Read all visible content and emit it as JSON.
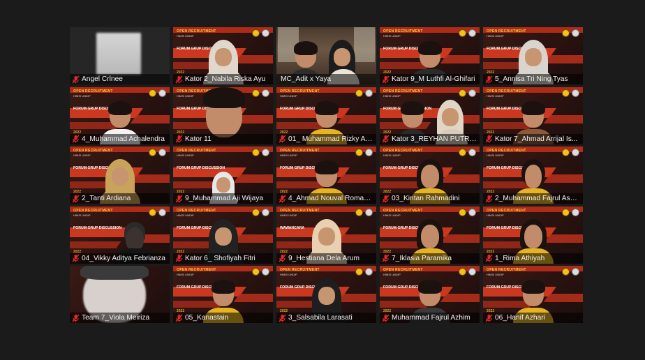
{
  "colors": {
    "background": "#1b1b1b",
    "active_speaker_border": "#c5e23a",
    "muted_icon": "#e02a2a",
    "virtual_bg_accent": "#c9381f",
    "shirt_yellow": "#e6b422"
  },
  "vbg": {
    "brand": "OPEN RECRUITMENT",
    "sub": "HIMSI UNDIP",
    "forum": "FORUM GRUP DISCUSSION",
    "interview": "WAWANCARA",
    "year": "2022"
  },
  "participants": [
    {
      "name": "Angel Crlnee",
      "muted": true,
      "kind": "blank"
    },
    {
      "name": "Kator 2_Nabila Riska Ayu",
      "muted": true,
      "kind": "hijab",
      "hijab": "#e0d8cc"
    },
    {
      "name": "MC_Adit x Yaya",
      "muted": false,
      "kind": "room"
    },
    {
      "name": "Kator 9_M Luthfi Al-Ghifari",
      "muted": true,
      "kind": "male",
      "shirt": "#2c2c2c"
    },
    {
      "name": "5_Annisa Tri Ning Tyas",
      "muted": true,
      "kind": "hijab",
      "hijab": "#d9d4cd"
    },
    {
      "name": "4_Muhammad Achalendra",
      "muted": true,
      "kind": "male",
      "shirt": "#f3f3f3"
    },
    {
      "name": "Kator 11",
      "muted": true,
      "kind": "closeup"
    },
    {
      "name": "01_ Muhammad Rizky Am...",
      "muted": true,
      "kind": "male",
      "shirt": "#e6b422",
      "active": true
    },
    {
      "name": "Kator 3_REYHAN PUTRA ...",
      "muted": true,
      "kind": "duo"
    },
    {
      "name": "Kator 7_Ahmad Arrijal Is...",
      "muted": true,
      "kind": "male",
      "shirt": "#8a5a3a"
    },
    {
      "name": "2_Tanti Ardiana",
      "muted": true,
      "kind": "hijab",
      "hijab": "#caa35a"
    },
    {
      "name": "9_Muhammad Aji Wijaya",
      "muted": true,
      "kind": "hoodie"
    },
    {
      "name": "4_Ahmad Nouval Romad...",
      "muted": true,
      "kind": "male",
      "shirt": "#e6b422"
    },
    {
      "name": "03_Kintan Rahmadini",
      "muted": true,
      "kind": "female",
      "shirt": "#e6b422"
    },
    {
      "name": "2_Muhammad Fajrul Assi...",
      "muted": true,
      "kind": "empty"
    },
    {
      "name": "04_Vikky Aditya Febrianza",
      "muted": true,
      "kind": "dark"
    },
    {
      "name": "Kator 6_ Shofiyah Fitri",
      "muted": true,
      "kind": "hijab",
      "hijab": "#222222"
    },
    {
      "name": "9_Hestiana Dela Arum",
      "muted": true,
      "kind": "hijab-interview",
      "hijab": "#e8d0b0"
    },
    {
      "name": "7_Iklasia Paramika",
      "muted": true,
      "kind": "female",
      "shirt": "#e6b422"
    },
    {
      "name": "1_Rima Athiyah",
      "muted": true,
      "kind": "female",
      "shirt": "#e6b422"
    },
    {
      "name": "Team 7_Viola Meiriza",
      "muted": true,
      "kind": "blurface"
    },
    {
      "name": "05_Kanastain",
      "muted": true,
      "kind": "male",
      "shirt": "#e6b422"
    },
    {
      "name": "3_Salsabila Larasati",
      "muted": true,
      "kind": "hijab",
      "hijab": "#1e1e1e"
    },
    {
      "name": "Muhammad Fajrul Azhim",
      "muted": true,
      "kind": "male",
      "shirt": "#3a3a3a"
    },
    {
      "name": "06_Hanif Azhari",
      "muted": true,
      "kind": "male",
      "shirt": "#e6b422"
    }
  ]
}
